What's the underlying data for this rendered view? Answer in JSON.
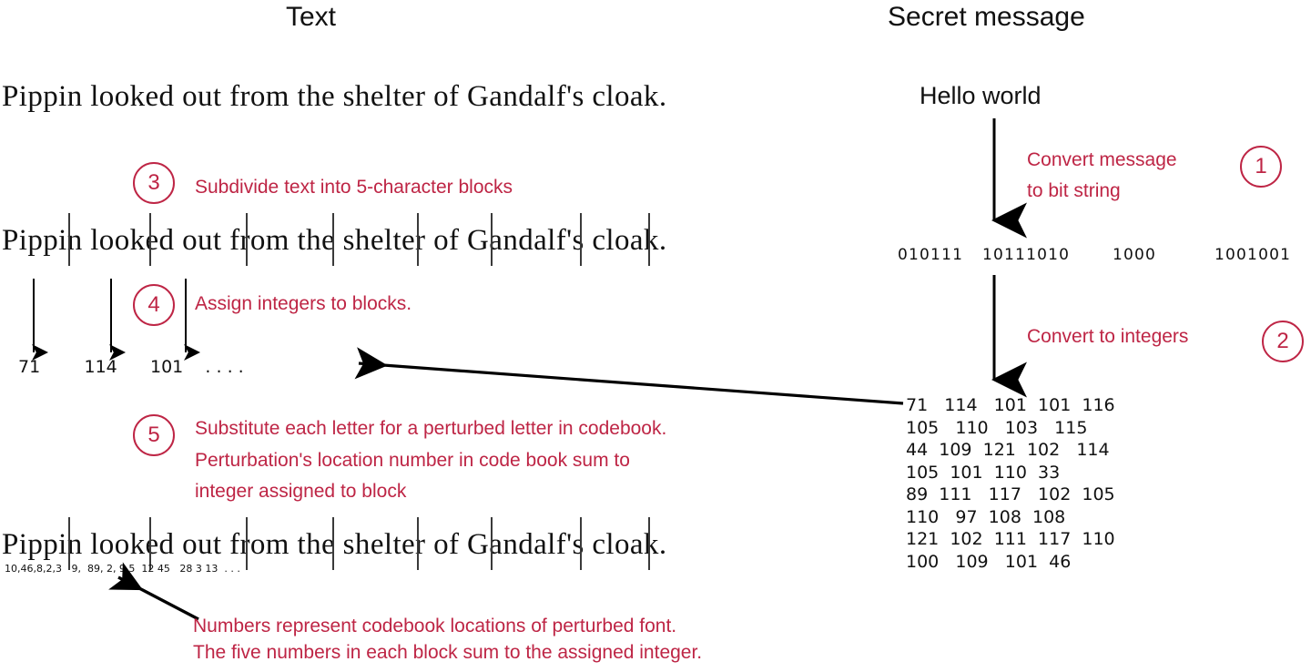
{
  "headers": {
    "left": "Text",
    "right": "Secret message"
  },
  "left_column": {
    "plain_text_line": "Pippin looked out from the shelter of Gandalf's cloak.",
    "blocked_text_line": "Pippin looked out from the shelter of Gandalf's cloak.",
    "perturbed_text_line": "Pippin looked out from the shelter of Gandalf's cloak.",
    "block_integers": "71        114      101    . . . .",
    "codebook_locations": "10,46,8,2,3   9,  89, 2, 9,5  12 45   28 3 13  . . ."
  },
  "right_column": {
    "message": "Hello world",
    "bit_string_groups": [
      "010111",
      "10111010",
      "1000",
      "1001001"
    ],
    "integer_rows": [
      "71   114   101  101  116",
      "105   110   103   115",
      "44  109  121  102   114",
      "105  101  110  33",
      "89  111   117   102  105",
      "110   97  108  108",
      "121  102  111  117  110",
      "100   109   101  46"
    ]
  },
  "steps": [
    {
      "number": "1",
      "lines": [
        "Convert message",
        "to bit string"
      ]
    },
    {
      "number": "2",
      "lines": [
        "Convert to integers"
      ]
    },
    {
      "number": "3",
      "lines": [
        "Subdivide text into 5-character blocks"
      ]
    },
    {
      "number": "4",
      "lines": [
        "Assign integers to blocks."
      ]
    },
    {
      "number": "5",
      "lines": [
        "Substitute each letter for a perturbed letter in codebook.",
        "Perturbation's location number in code book sum to",
        "integer assigned to block"
      ]
    }
  ],
  "footnote": {
    "line1": "Numbers represent codebook locations of perturbed font.",
    "line2": "The five numbers in each block sum to the assigned integer."
  },
  "colors": {
    "annotation_red": "#BE2545",
    "text_black": "#111111"
  }
}
